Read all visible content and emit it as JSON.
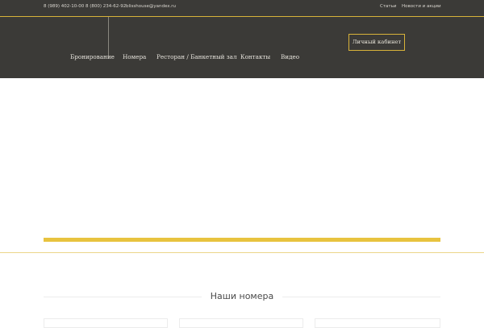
{
  "topbar": {
    "phones": "8 (989) 402-10-00 8 (800) 234-62-92",
    "email": "blisshouse@yandex.ru",
    "links": [
      "Статьи",
      "Новости и акции"
    ]
  },
  "nav": {
    "items": [
      "Бронирование",
      "Номера",
      "Ресторан / Банкетный зал",
      "Контакты",
      "Видео"
    ],
    "cabinet_label": "Личный кабинет"
  },
  "rooms_section": {
    "title": "Наши номера"
  },
  "colors": {
    "header_bg": "#3b3a37",
    "accent": "#e8c33f"
  }
}
